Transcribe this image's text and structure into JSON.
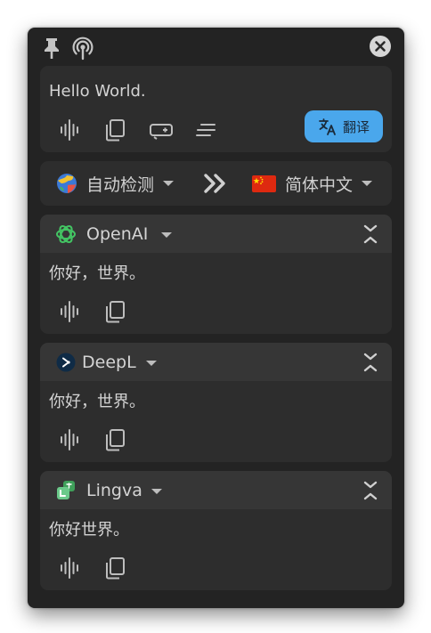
{
  "source": {
    "text": "Hello World.",
    "translate_button": "翻译"
  },
  "languages": {
    "from": "自动检测",
    "to": "简体中文"
  },
  "services": [
    {
      "name": "OpenAI",
      "result": "你好，世界。"
    },
    {
      "name": "DeepL",
      "result": "你好，世界。"
    },
    {
      "name": "Lingva",
      "result": "你好世界。"
    }
  ],
  "colors": {
    "window_bg": "#232323",
    "card_bg": "#2d2d2d",
    "card_header_bg": "#363636",
    "accent": "#4aa7ec",
    "text": "#d4d4d4",
    "icon": "#bdbdbd"
  },
  "icons": {
    "titlebar": [
      "pin-icon",
      "radar-icon",
      "close-icon"
    ],
    "source_actions": [
      "speak-icon",
      "copy-icon",
      "delete-newline-icon",
      "clear-icon"
    ],
    "result_actions": [
      "speak-icon",
      "copy-icon"
    ]
  }
}
